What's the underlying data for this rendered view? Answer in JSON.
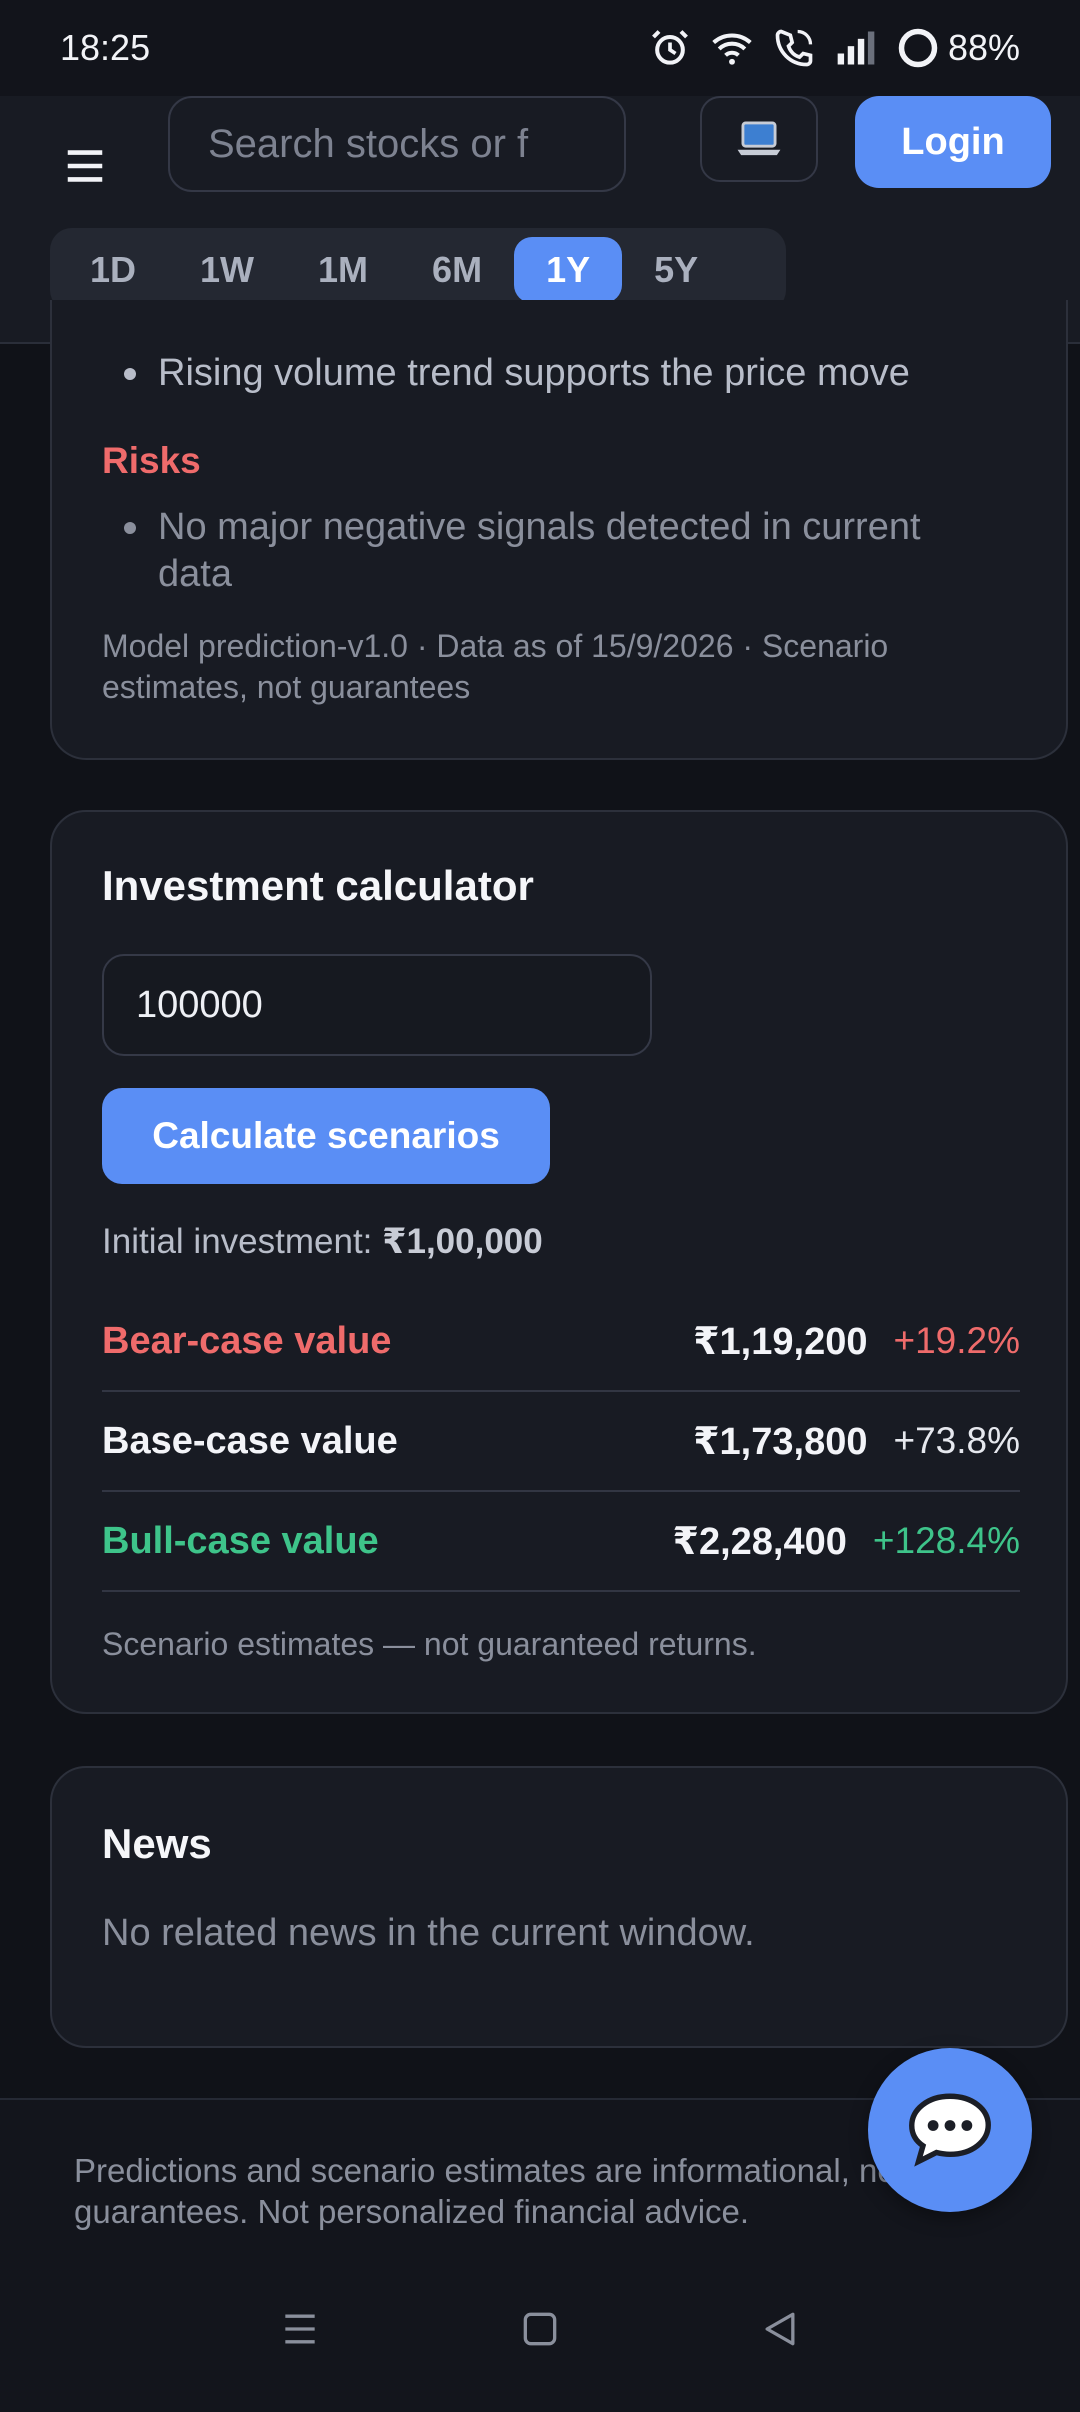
{
  "status_bar": {
    "time": "18:25",
    "battery": "88%",
    "icons": [
      "alarm-icon",
      "wifi-icon",
      "wifi-call-icon",
      "signal-icon",
      "battery-ring-icon"
    ]
  },
  "header": {
    "search_placeholder": "Search stocks or f",
    "theme_icon": "laptop-icon",
    "login_label": "Login",
    "range_tabs": [
      "1D",
      "1W",
      "1M",
      "6M",
      "1Y",
      "5Y"
    ],
    "active_range": "1Y"
  },
  "analysis": {
    "support_bullet": "Rising volume trend supports the price move",
    "risks_title": "Risks",
    "risk_bullet": "No major negative signals detected in current data",
    "model_note": "Model prediction-v1.0 · Data as of 15/9/2026 · Scenario estimates, not guarantees"
  },
  "calculator": {
    "title": "Investment calculator",
    "amount_value": "100000",
    "calculate_label": "Calculate scenarios",
    "initial_label": "Initial investment:",
    "initial_value": "₹1,00,000",
    "scenarios": [
      {
        "label": "Bear-case value",
        "value": "₹1,19,200",
        "pct": "+19.2%"
      },
      {
        "label": "Base-case value",
        "value": "₹1,73,800",
        "pct": "+73.8%"
      },
      {
        "label": "Bull-case value",
        "value": "₹2,28,400",
        "pct": "+128.4%"
      }
    ],
    "disclaimer": "Scenario estimates — not guaranteed returns."
  },
  "news": {
    "title": "News",
    "empty_text": "No related news in the current window."
  },
  "footer": {
    "text": "Predictions and scenario estimates are informational, not guarantees. Not personalized financial advice."
  },
  "colors": {
    "accent": "#5a8ef5",
    "bear": "#ef6b6b",
    "bull": "#3ec48a",
    "background": "#101218",
    "card": "#181b23"
  }
}
